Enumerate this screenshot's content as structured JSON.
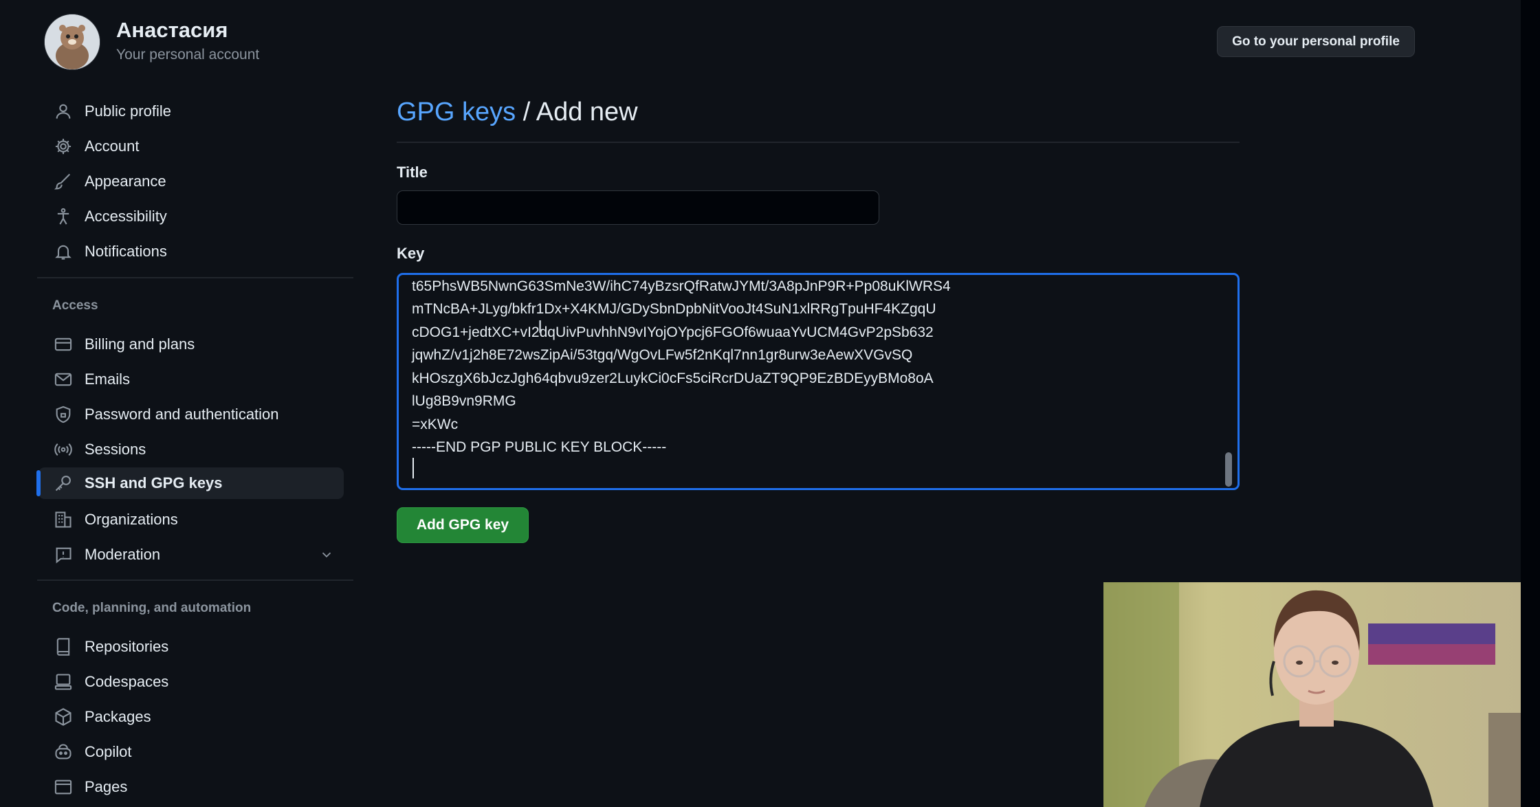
{
  "header": {
    "user_name": "Анастасия",
    "user_subtitle": "Your personal account",
    "profile_button": "Go to your personal profile"
  },
  "sidebar": {
    "items_top": [
      {
        "label": "Public profile",
        "icon": "person-icon"
      },
      {
        "label": "Account",
        "icon": "gear-icon"
      },
      {
        "label": "Appearance",
        "icon": "paintbrush-icon"
      },
      {
        "label": "Accessibility",
        "icon": "accessibility-icon"
      },
      {
        "label": "Notifications",
        "icon": "bell-icon"
      }
    ],
    "access_heading": "Access",
    "items_access": [
      {
        "label": "Billing and plans",
        "icon": "credit-card-icon"
      },
      {
        "label": "Emails",
        "icon": "mail-icon"
      },
      {
        "label": "Password and authentication",
        "icon": "shield-lock-icon"
      },
      {
        "label": "Sessions",
        "icon": "broadcast-icon"
      },
      {
        "label": "SSH and GPG keys",
        "icon": "key-icon",
        "selected": true
      },
      {
        "label": "Organizations",
        "icon": "organization-icon"
      },
      {
        "label": "Moderation",
        "icon": "report-icon",
        "expandable": true
      }
    ],
    "code_heading": "Code, planning, and automation",
    "items_code": [
      {
        "label": "Repositories",
        "icon": "repo-icon"
      },
      {
        "label": "Codespaces",
        "icon": "codespaces-icon"
      },
      {
        "label": "Packages",
        "icon": "package-icon"
      },
      {
        "label": "Copilot",
        "icon": "copilot-icon"
      },
      {
        "label": "Pages",
        "icon": "browser-icon"
      }
    ]
  },
  "main": {
    "breadcrumb_link": "GPG keys",
    "breadcrumb_sep": " / ",
    "breadcrumb_current": "Add new",
    "title_label": "Title",
    "title_value": "",
    "key_label": "Key",
    "key_lines": [
      "t65PhsWB5NwnG63SmNe3W/ihC74yBzsrQfRatwJYMt/3A8pJnP9R+Pp08uKlWRS4",
      "mTNcBA+JLyg/bkfr1Dx+X4KMJ/GDySbnDpbNitVooJt4SuN1xlRRgTpuHF4KZgqU",
      "cDOG1+jedtXC+vI2dqUivPuvhhN9vIYojOYpcj6FGOf6wuaaYvUCM4GvP2pSb632",
      "jqwhZ/v1j2h8E72wsZipAi/53tgq/WgOvLFw5f2nKql7nn1gr8urw3eAewXVGvSQ",
      "kHOszgX6bJczJgh64qbvu9zer2LuykCi0cFs5ciRcrDUaZT9QP9EzBDEyyBMo8oA",
      "lUg8B9vn9RMG",
      "=xKWc",
      "-----END PGP PUBLIC KEY BLOCK-----"
    ],
    "submit_label": "Add GPG key"
  },
  "colors": {
    "background": "#0d1117",
    "accent_blue": "#1f6feb",
    "link_blue": "#58a6ff",
    "button_green": "#238636",
    "muted_text": "#8b949e"
  }
}
